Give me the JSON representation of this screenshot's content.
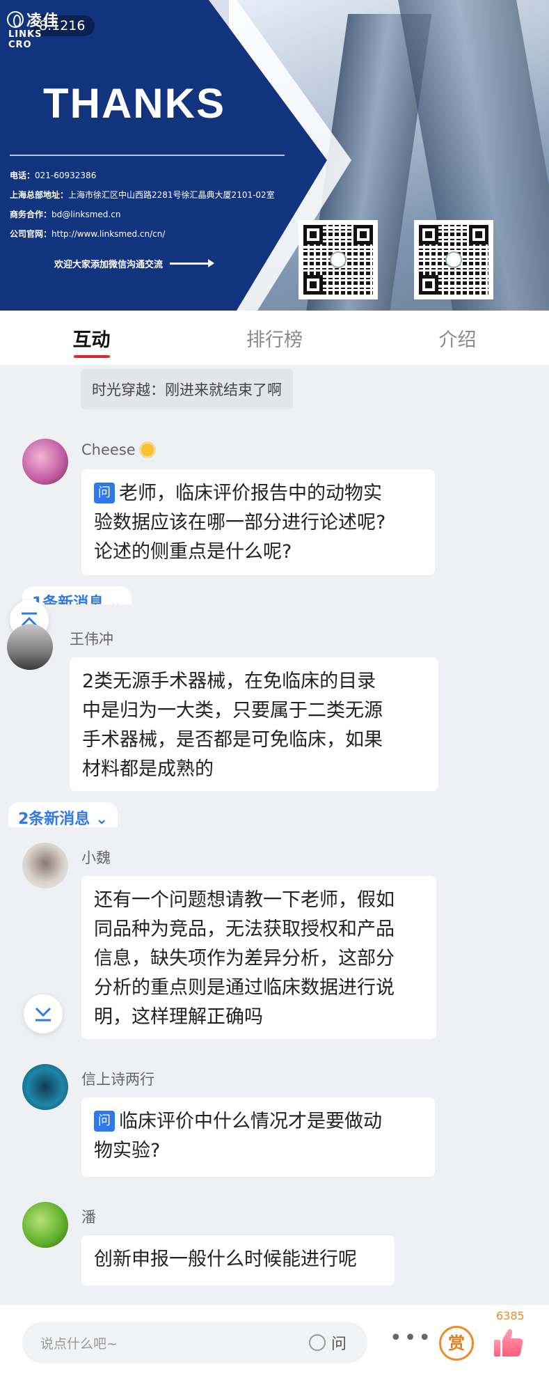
{
  "banner": {
    "logo_cn": "凌佳",
    "logo_en": "LINKS CRO",
    "viewer_count": "8.1216",
    "headline": "THANKS",
    "phone_label": "电话：",
    "phone": "021-60932386",
    "address_label": "上海总部地址：",
    "address": "上海市徐汇区中山西路2281号徐汇晶典大厦2101-02室",
    "biz_label": "商务合作：",
    "biz": "bd@linksmed.cn",
    "site_label": "公司官网：",
    "site": "http://www.linksmed.cn/cn/",
    "cta": "欢迎大家添加微信沟通交流"
  },
  "tabs": [
    {
      "label": "互动",
      "active": true
    },
    {
      "label": "排行榜",
      "active": false
    },
    {
      "label": "介绍",
      "active": false
    }
  ],
  "system_message": "时光穿越：刚进来就结束了啊",
  "messages": [
    {
      "user": "Cheese",
      "question_tag": "问",
      "lines": [
        "老师，临床评价报告中的动物实",
        "验数据应该在哪一部分进行论述呢?",
        "论述的侧重点是什么呢?"
      ]
    },
    {
      "user": "王伟冲",
      "lines": [
        "2类无源手术器械，在免临床的目录",
        "中是归为一大类，只要属于二类无源",
        "手术器械，是否都是可免临床，如果",
        "材料都是成熟的"
      ]
    },
    {
      "user": "小魏",
      "lines": [
        "还有一个问题想请教一下老师，假如",
        "同品种为竞品，无法获取授权和产品",
        "信息，缺失项作为差异分析，这部分",
        "分析的重点则是通过临床数据进行说",
        "明，这样理解正确吗"
      ]
    },
    {
      "user": "信上诗两行",
      "question_tag": "问",
      "lines": [
        "临床评价中什么情况才是要做动",
        "物实验?"
      ]
    },
    {
      "user": "潘",
      "lines": [
        "创新申报一般什么时候能进行呢"
      ]
    }
  ],
  "new_messages": [
    "1条新消息",
    "2条新消息"
  ],
  "input": {
    "placeholder": "说点什么吧~",
    "ask_label": "问"
  },
  "reward_label": "赏",
  "like_count": "6385",
  "colors": {
    "accent_red": "#e0282c",
    "link_blue": "#2f78e8",
    "banner_blue": "#12347f",
    "reward_orange": "#f08a24"
  }
}
